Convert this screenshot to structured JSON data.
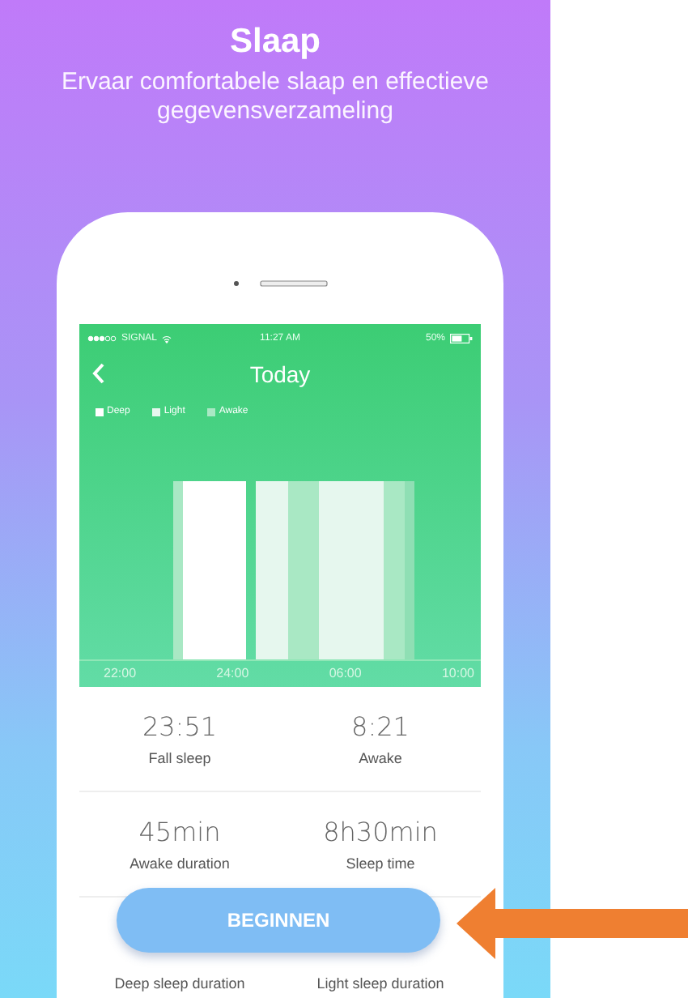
{
  "header": {
    "title": "Slaap",
    "subtitle": "Ervaar comfortabele slaap en effectieve gegevensverzameling"
  },
  "phone": {
    "status_bar": {
      "carrier": "SIGNAL",
      "time": "11:27 AM",
      "battery": "50%"
    },
    "nav": {
      "title": "Today"
    },
    "legend": [
      {
        "label": "Deep",
        "color": "#ffffff"
      },
      {
        "label": "Light",
        "color": "#e6f7ee"
      },
      {
        "label": "Awake",
        "color": "#a9e8c4"
      }
    ],
    "x_labels": [
      "22:00",
      "24:00",
      "06:00",
      "10:00"
    ],
    "stats": [
      {
        "value": "23:51",
        "label": "Fall sleep"
      },
      {
        "value": "8:21",
        "label": "Awake"
      },
      {
        "value": "45min",
        "label": "Awake duration"
      },
      {
        "value": "8h30min",
        "label": "Sleep time"
      },
      {
        "label": "Deep sleep duration"
      },
      {
        "label": "Light sleep duration"
      }
    ]
  },
  "button": {
    "label": "BEGINNEN"
  }
}
